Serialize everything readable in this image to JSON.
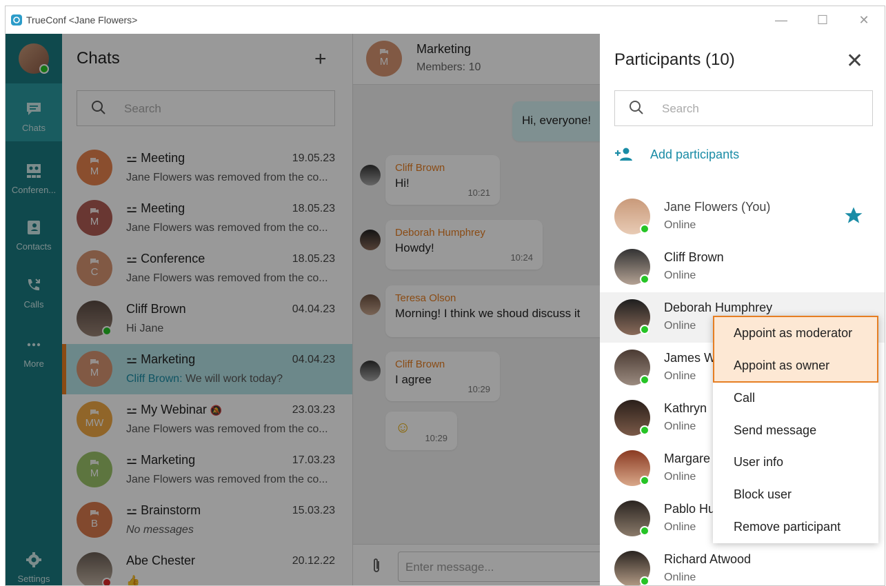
{
  "window": {
    "title": "TrueConf <Jane Flowers>",
    "minimize": "—",
    "maximize": "☐",
    "close": "✕"
  },
  "rail": {
    "items": [
      {
        "label": "Chats",
        "icon": "chat-icon"
      },
      {
        "label": "Conferen...",
        "icon": "conference-icon"
      },
      {
        "label": "Contacts",
        "icon": "contacts-icon"
      },
      {
        "label": "Calls",
        "icon": "calls-icon"
      },
      {
        "label": "More",
        "icon": "more-icon"
      },
      {
        "label": "Settings",
        "icon": "gear-icon"
      }
    ]
  },
  "chatlist": {
    "title": "Chats",
    "add": "+",
    "search_placeholder": "Search",
    "chats": [
      {
        "name": "Meeting",
        "date": "19.05.23",
        "preview": "Jane Flowers was removed from the co...",
        "initials": "M",
        "color": "#e7834d"
      },
      {
        "name": "Meeting",
        "date": "18.05.23",
        "preview": "Jane Flowers was removed from the co...",
        "initials": "M",
        "color": "#b05c54"
      },
      {
        "name": "Conference",
        "date": "18.05.23",
        "preview": "Jane Flowers was removed from the co...",
        "initials": "C",
        "color": "#d89472"
      },
      {
        "name": "Cliff Brown",
        "date": "04.04.23",
        "preview": "Hi Jane",
        "initials": "",
        "color": "#7a6a60"
      },
      {
        "name": "Marketing",
        "date": "04.04.23",
        "preview_sender": "Cliff Brown:",
        "preview": "We will work today?",
        "initials": "M",
        "color": "#d89472"
      },
      {
        "name": "My Webinar",
        "date": "23.03.23",
        "preview": "Jane Flowers was removed from the co...",
        "initials": "MW",
        "color": "#f0a845"
      },
      {
        "name": "Marketing",
        "date": "17.03.23",
        "preview": "Jane Flowers was removed from the co...",
        "initials": "M",
        "color": "#9cc46a"
      },
      {
        "name": "Brainstorm",
        "date": "15.03.23",
        "preview": "No messages",
        "initials": "B",
        "color": "#d97a4e"
      },
      {
        "name": "Abe Chester",
        "date": "20.12.22",
        "preview": "👍",
        "initials": "",
        "color": "#9a8f86"
      }
    ]
  },
  "chat": {
    "title": "Marketing",
    "subtitle": "Members: 10",
    "avatar_initials": "M",
    "messages": [
      {
        "own": true,
        "text": "Hi, everyone!"
      },
      {
        "sender": "Cliff Brown",
        "text": "Hi!",
        "time": "10:21"
      },
      {
        "sender": "Deborah Humphrey",
        "text": "Howdy!",
        "time": "10:24"
      },
      {
        "sender": "Teresa Olson",
        "text": "Morning! I think we shoud discuss it"
      },
      {
        "sender": "Cliff Brown",
        "text": "I agree",
        "time": "10:29"
      },
      {
        "text": "☺",
        "time": "10:29"
      }
    ],
    "composer_placeholder": "Enter message..."
  },
  "participants": {
    "title": "Participants (10)",
    "close": "✕",
    "search_placeholder": "Search",
    "add_label": "Add participants",
    "list": [
      {
        "name": "Jane Flowers (You)",
        "status": "Online"
      },
      {
        "name": "Cliff Brown",
        "status": "Online"
      },
      {
        "name": "Deborah Humphrey",
        "status": "Online"
      },
      {
        "name": "James W",
        "status": "Online"
      },
      {
        "name": "Kathryn",
        "status": "Online"
      },
      {
        "name": "Margare",
        "status": "Online"
      },
      {
        "name": "Pablo Hu",
        "status": "Online"
      },
      {
        "name": "Richard Atwood",
        "status": "Online"
      }
    ]
  },
  "context_menu": {
    "items": [
      "Appoint as moderator",
      "Appoint as owner",
      "Call",
      "Send message",
      "User info",
      "Block user",
      "Remove participant"
    ]
  },
  "colors": {
    "rail": "#1a7a80",
    "accent": "#1a8ca6",
    "highlight": "#e67e22",
    "online": "#26c426"
  }
}
